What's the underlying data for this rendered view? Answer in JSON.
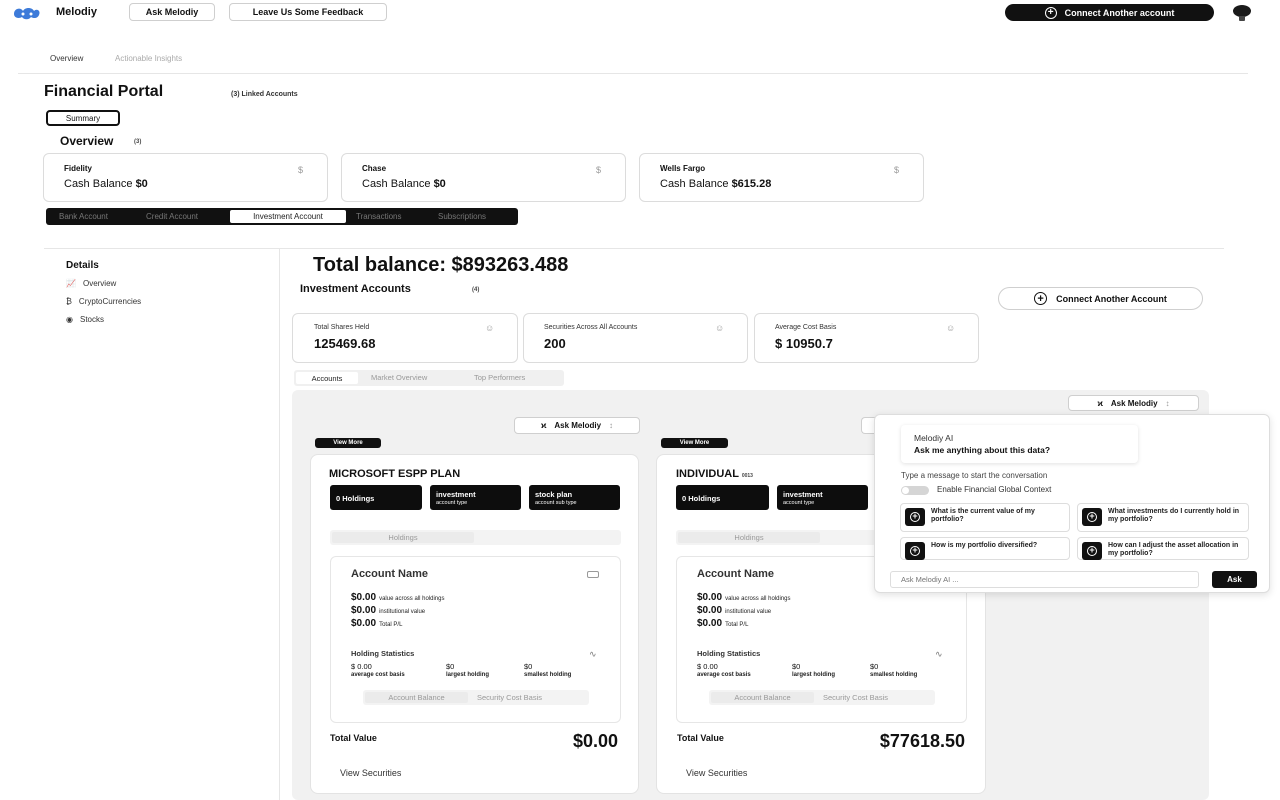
{
  "app": {
    "name": "Melodiy",
    "ask_button": "Ask Melodiy",
    "feedback_button": "Leave Us Some Feedback",
    "connect_account_button": "Connect Another account"
  },
  "top_tabs": [
    "Overview",
    "Actionable Insights"
  ],
  "portal": {
    "title": "Financial Portal",
    "linked_accounts": "(3) Linked Accounts",
    "summary_button": "Summary",
    "overview_heading": "Overview",
    "overview_count": "(3)"
  },
  "bank_cards": [
    {
      "name": "Fidelity",
      "label": "Cash Balance",
      "value": "$0",
      "icon": "$"
    },
    {
      "name": "Chase",
      "label": "Cash Balance",
      "value": "$0",
      "icon": "$"
    },
    {
      "name": "Wells Fargo",
      "label": "Cash Balance",
      "value": "$615.28",
      "icon": "$"
    }
  ],
  "account_tabs": [
    "Bank Account",
    "Credit Account",
    "Investment Account",
    "Transactions",
    "Subscriptions"
  ],
  "account_tabs_active": "Investment Account",
  "details": {
    "heading": "Details",
    "items": [
      {
        "label": "Overview",
        "icon": "chart-icon"
      },
      {
        "label": "CryptoCurrencies",
        "icon": "bitcoin-icon"
      },
      {
        "label": "Stocks",
        "icon": "eye-icon"
      }
    ]
  },
  "investments": {
    "total_balance": "Total balance: $893263.488",
    "heading": "Investment Accounts",
    "count": "(4)",
    "connect_button": "Connect Another Account",
    "stats": [
      {
        "label": "Total Shares Held",
        "value": "125469.68"
      },
      {
        "label": "Securities Across All Accounts",
        "value": "200"
      },
      {
        "label": "Average Cost Basis",
        "value": "$ 10950.7"
      }
    ],
    "subtabs": [
      "Accounts",
      "Market Overview",
      "Top Performers"
    ],
    "ask_button": "Ask Melodiy",
    "view_more": "View More"
  },
  "accounts": [
    {
      "title": "MICROSOFT ESPP PLAN",
      "suffix": "",
      "tiles": [
        {
          "main": "0 Holdings",
          "sub": ""
        },
        {
          "main": "investment",
          "sub": "account type"
        },
        {
          "main": "stock plan",
          "sub": "account sub type"
        }
      ],
      "holdings_tab": "Holdings",
      "account_name": "Account Name",
      "values": [
        {
          "amount": "$0.00",
          "label": "value across all holdings"
        },
        {
          "amount": "$0.00",
          "label": "institutional value"
        },
        {
          "amount": "$0.00",
          "label": "Total P/L"
        }
      ],
      "holding_stats_title": "Holding Statistics",
      "holding_stats": [
        {
          "value": "$ 0.00",
          "label": "average cost basis"
        },
        {
          "value": "$0",
          "label": "largest holding"
        },
        {
          "value": "$0",
          "label": "smallest holding"
        }
      ],
      "balance_tabs": [
        "Account Balance",
        "Security Cost Basis"
      ],
      "total_label": "Total Value",
      "total_value": "$0.00",
      "view_securities": "View Securities"
    },
    {
      "title": "INDIVIDUAL",
      "suffix": "0013",
      "tiles": [
        {
          "main": "0 Holdings",
          "sub": ""
        },
        {
          "main": "investment",
          "sub": "account type"
        }
      ],
      "holdings_tab": "Holdings",
      "account_name": "Account Name",
      "values": [
        {
          "amount": "$0.00",
          "label": "value across all holdings"
        },
        {
          "amount": "$0.00",
          "label": "institutional value"
        },
        {
          "amount": "$0.00",
          "label": "Total P/L"
        }
      ],
      "holding_stats_title": "Holding Statistics",
      "holding_stats": [
        {
          "value": "$ 0.00",
          "label": "average cost basis"
        },
        {
          "value": "$0",
          "label": "largest holding"
        },
        {
          "value": "$0",
          "label": "smallest holding"
        }
      ],
      "balance_tabs": [
        "Account Balance",
        "Security Cost Basis"
      ],
      "total_label": "Total Value",
      "total_value": "$77618.50",
      "view_securities": "View Securities"
    }
  ],
  "chat": {
    "ask_button": "Ask Melodiy",
    "title": "Melodiy AI",
    "prompt": "Ask me anything about this data?",
    "hint": "Type a message to start the conversation",
    "toggle_label": "Enable Financial Global Context",
    "suggestions": [
      "What is the current value of my portfolio?",
      "What investments do I currently hold in my portfolio?",
      "How is my portfolio diversified?",
      "How can I adjust the asset allocation in my portfolio?"
    ],
    "input_placeholder": "Ask Melodiy AI ...",
    "send_button": "Ask"
  }
}
